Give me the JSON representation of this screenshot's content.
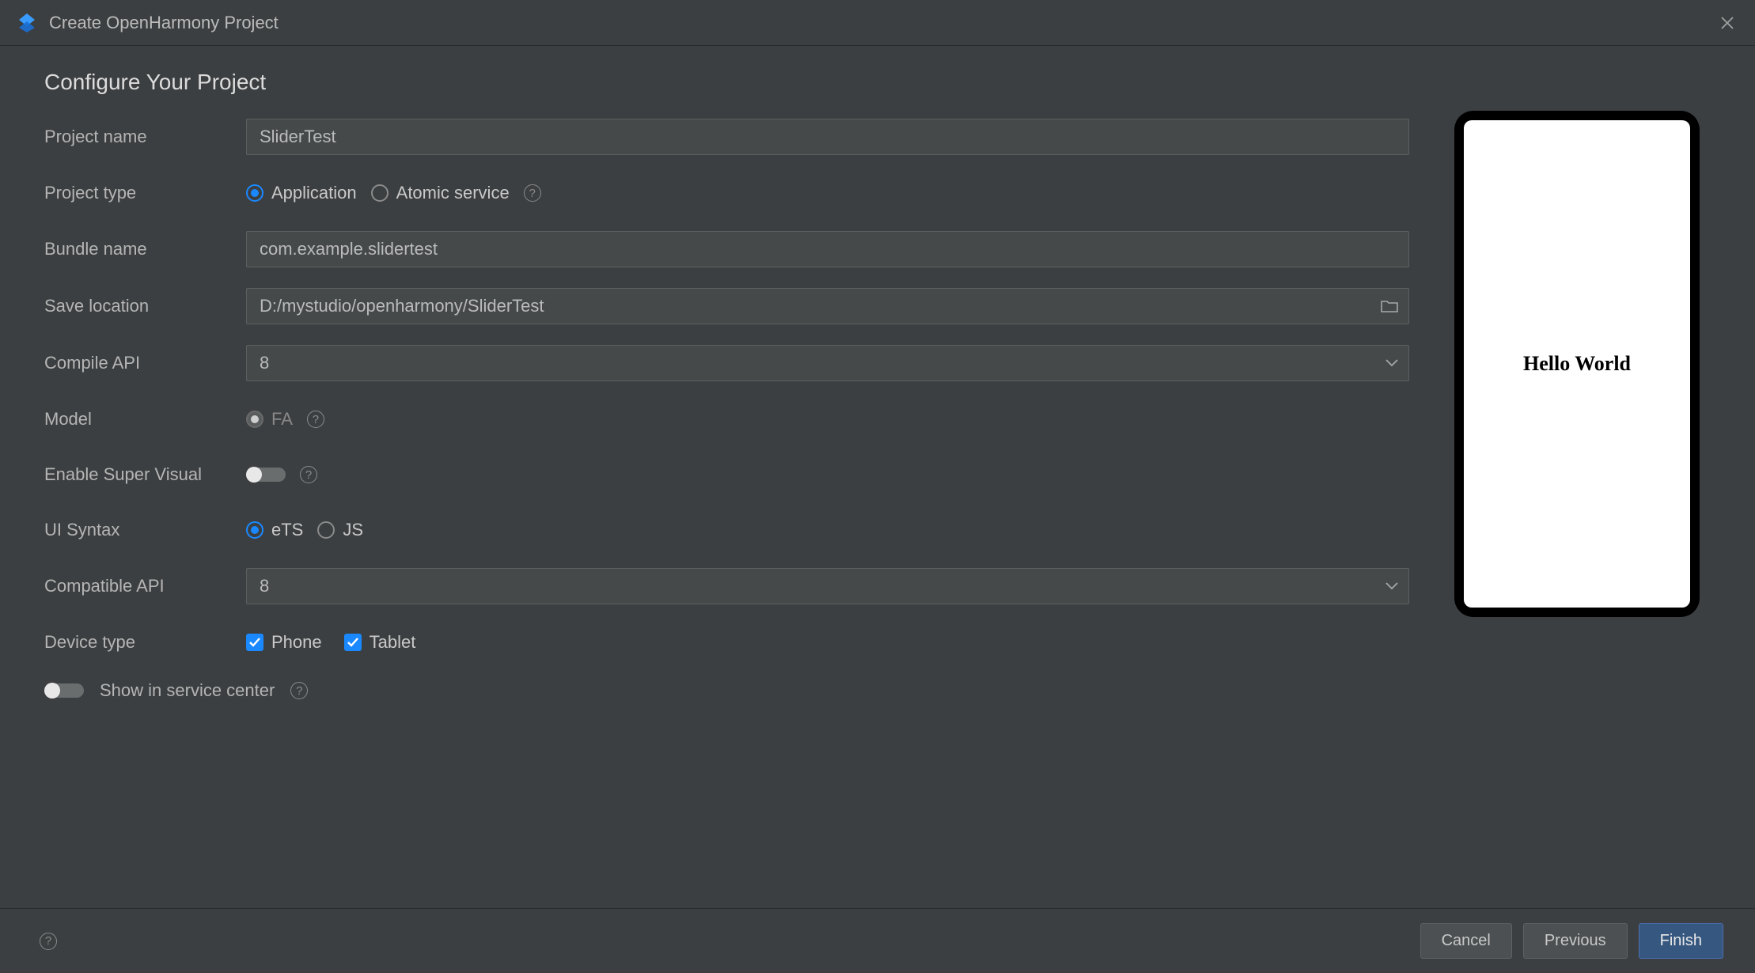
{
  "titlebar": {
    "title": "Create OpenHarmony Project"
  },
  "heading": "Configure Your Project",
  "labels": {
    "project_name": "Project name",
    "project_type": "Project type",
    "bundle_name": "Bundle name",
    "save_location": "Save location",
    "compile_api": "Compile API",
    "model": "Model",
    "enable_super_visual": "Enable Super Visual",
    "ui_syntax": "UI Syntax",
    "compatible_api": "Compatible API",
    "device_type": "Device type",
    "show_in_service_center": "Show in service center"
  },
  "values": {
    "project_name": "SliderTest",
    "bundle_name": "com.example.slidertest",
    "save_location": "D:/mystudio/openharmony/SliderTest",
    "compile_api": "8",
    "compatible_api": "8"
  },
  "project_type": {
    "options": [
      "Application",
      "Atomic service"
    ],
    "selected": "Application"
  },
  "model": {
    "options": [
      "FA"
    ],
    "selected": "FA"
  },
  "ui_syntax": {
    "options": [
      "eTS",
      "JS"
    ],
    "selected": "eTS"
  },
  "device_type": {
    "options": [
      {
        "label": "Phone",
        "checked": true
      },
      {
        "label": "Tablet",
        "checked": true
      }
    ]
  },
  "enable_super_visual": false,
  "show_in_service_center": false,
  "preview": {
    "text": "Hello World"
  },
  "footer": {
    "cancel": "Cancel",
    "previous": "Previous",
    "finish": "Finish"
  },
  "colors": {
    "accent": "#1a88ff",
    "primary_button": "#365880",
    "bg": "#3c3f41",
    "input_bg": "#45494a"
  }
}
